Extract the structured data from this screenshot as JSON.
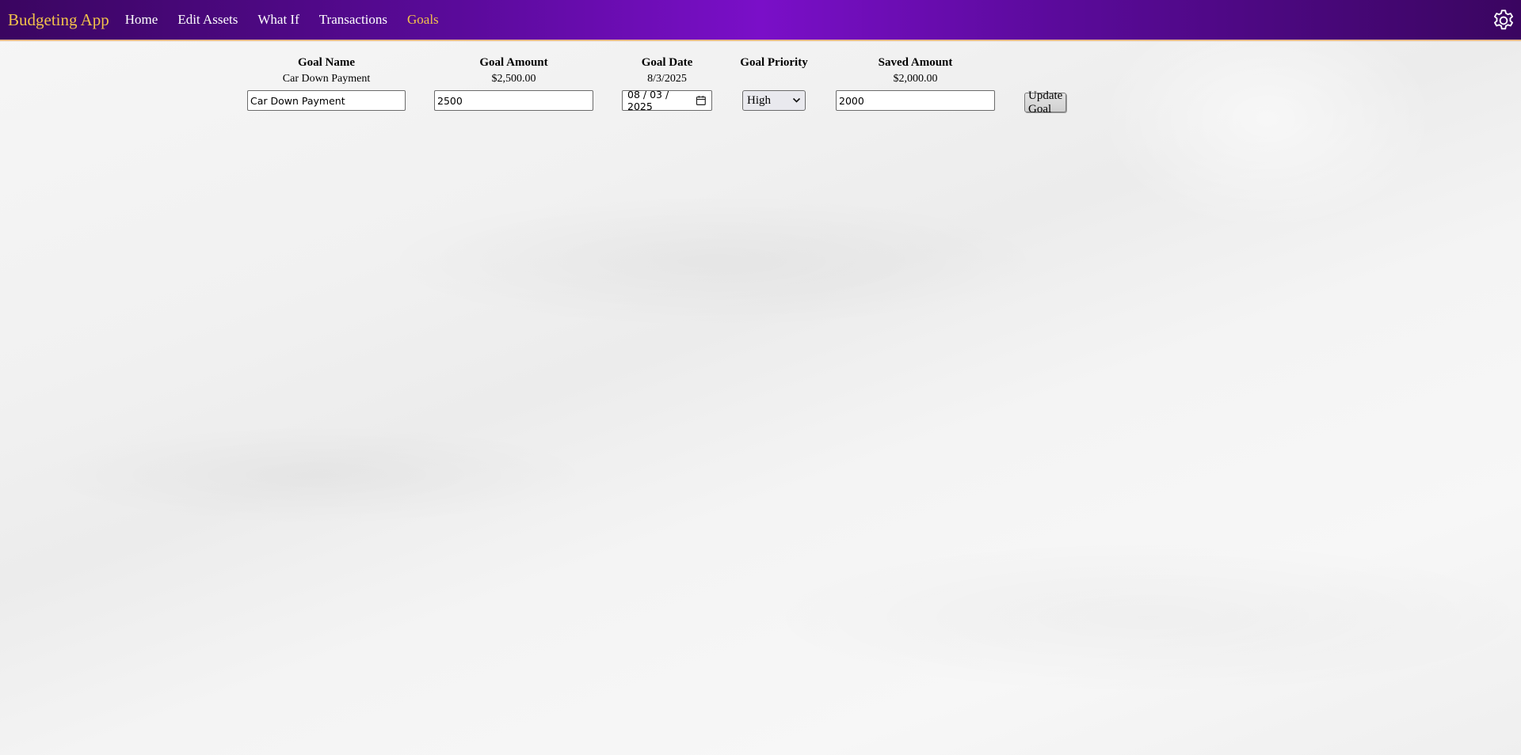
{
  "nav": {
    "brand": "Budgeting App",
    "links": [
      "Home",
      "Edit Assets",
      "What If",
      "Transactions",
      "Goals"
    ],
    "active": "Goals",
    "settings_icon": "gear-icon"
  },
  "goals": {
    "headers": {
      "name": "Goal Name",
      "amount": "Goal Amount",
      "date": "Goal Date",
      "priority": "Goal Priority",
      "saved": "Saved Amount"
    },
    "rows": [
      {
        "name_display": "Car Down Payment",
        "amount_display": "$2,500.00",
        "date_display": "8/3/2025",
        "saved_display": "$2,000.00",
        "name_input": "Car Down Payment",
        "amount_input": "2500",
        "date_input": "08 / 03 / 2025",
        "priority_selected": "High",
        "saved_input": "2000",
        "update_label": "Update Goal"
      }
    ]
  },
  "colors": {
    "nav_gradient_start": "#3a0560",
    "nav_gradient_mid": "#7a0fc8",
    "accent_gold": "#f2c24b",
    "nav_border": "#e7b98a"
  }
}
